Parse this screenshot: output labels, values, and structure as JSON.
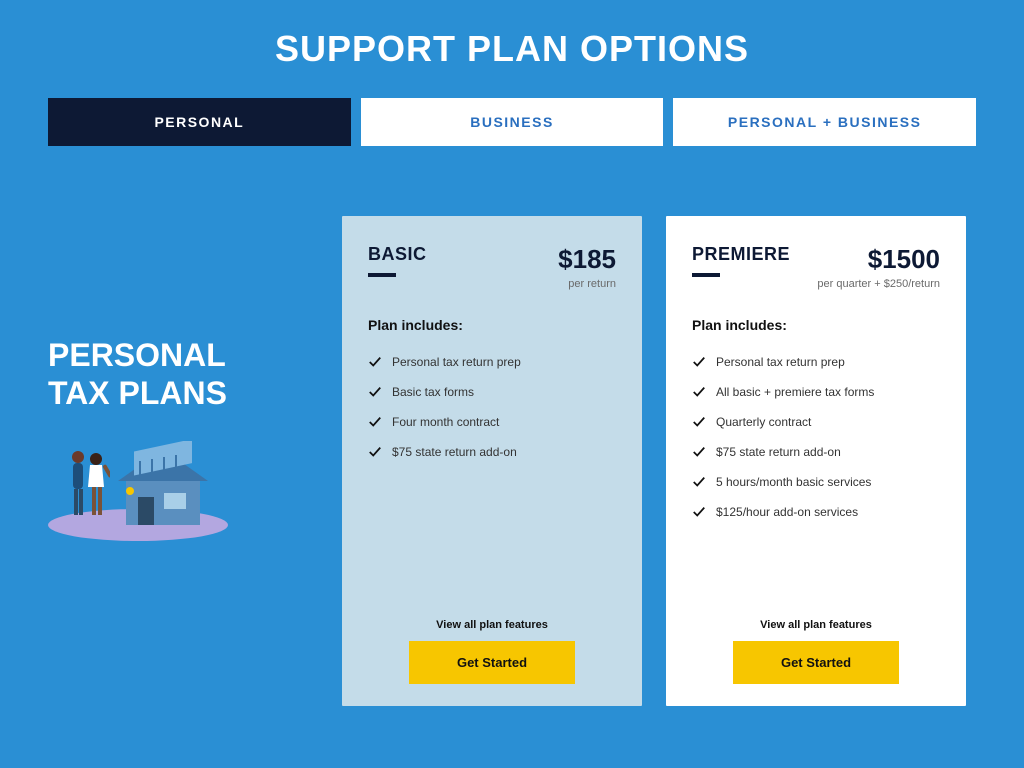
{
  "title": "SUPPORT PLAN OPTIONS",
  "tabs": [
    {
      "label": "PERSONAL",
      "active": true
    },
    {
      "label": "BUSINESS",
      "active": false
    },
    {
      "label": "PERSONAL + BUSINESS",
      "active": false
    }
  ],
  "left": {
    "heading_line1": "PERSONAL",
    "heading_line2": "TAX PLANS"
  },
  "includes_label": "Plan includes:",
  "view_all_label": "View all plan features",
  "cta_label": "Get Started",
  "plans": {
    "basic": {
      "name": "BASIC",
      "price": "$185",
      "price_sub": "per return",
      "features": [
        "Personal tax return prep",
        "Basic tax forms",
        "Four month contract",
        "$75 state return add-on"
      ]
    },
    "premiere": {
      "name": "PREMIERE",
      "price": "$1500",
      "price_sub": "per quarter + $250/return",
      "features": [
        "Personal tax return prep",
        "All basic + premiere tax forms",
        "Quarterly contract",
        "$75 state return add-on",
        "5 hours/month basic services",
        "$125/hour add-on services"
      ]
    }
  },
  "colors": {
    "bg": "#2a8fd4",
    "dark": "#0d1934",
    "accent": "#f7c600",
    "card_basic": "#c4dce9",
    "card_premiere": "#ffffff"
  }
}
